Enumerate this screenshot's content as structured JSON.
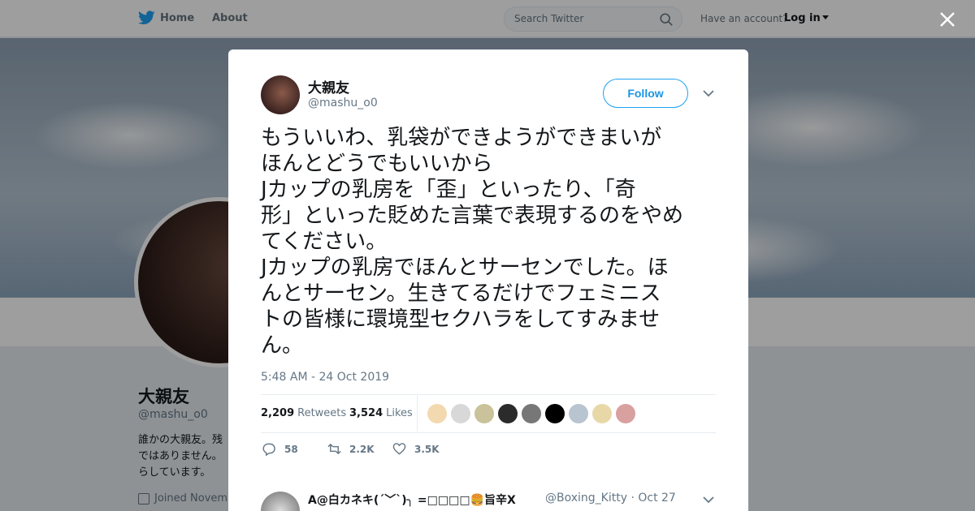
{
  "nav": {
    "home_label": "Home",
    "about_label": "About",
    "search_placeholder": "Search Twitter",
    "have_account": "Have an account?",
    "login_label": "Log in"
  },
  "profile": {
    "name": "大親友",
    "handle": "@mashu_o0",
    "bio": "誰かの大親友。残\nではありません。\nらしています。",
    "joined": "Joined Novem"
  },
  "tweet": {
    "author_name": "大親友",
    "author_handle": "@mashu_o0",
    "follow_label": "Follow",
    "text": "もういいわ、乳袋ができようができまいが\nほんとどうでもいいから\nJカップの乳房を「歪」といったり、「奇\n形」といった貶めた言葉で表現するのをやめ\nてください。\nJカップの乳房でほんとサーセンでした。ほ\nんとサーセン。生きてるだけでフェミニス\nトの皆様に環境型セクハラをしてすみませ\nん。",
    "timestamp": "5:48 AM - 24 Oct 2019",
    "retweets_count": "2,209",
    "retweets_label": "Retweets",
    "likes_count": "3,524",
    "likes_label": "Likes",
    "likers": [
      "#f3d9b0",
      "#d8d8d8",
      "#c9c29a",
      "#2b2b2b",
      "#777777",
      "#000000",
      "#b8c4d0",
      "#e8d8a8",
      "#d9a0a0"
    ],
    "replies": "58",
    "retweets_short": "2.2K",
    "likes_short": "3.5K"
  },
  "reply": {
    "name": "A@白カネキ(´﹀`)╮ =□□□□🍔旨辛X",
    "handle": "@Boxing_Kitty · Oct 27"
  },
  "colors": {
    "brand": "#1da1f2",
    "muted": "#657786"
  }
}
